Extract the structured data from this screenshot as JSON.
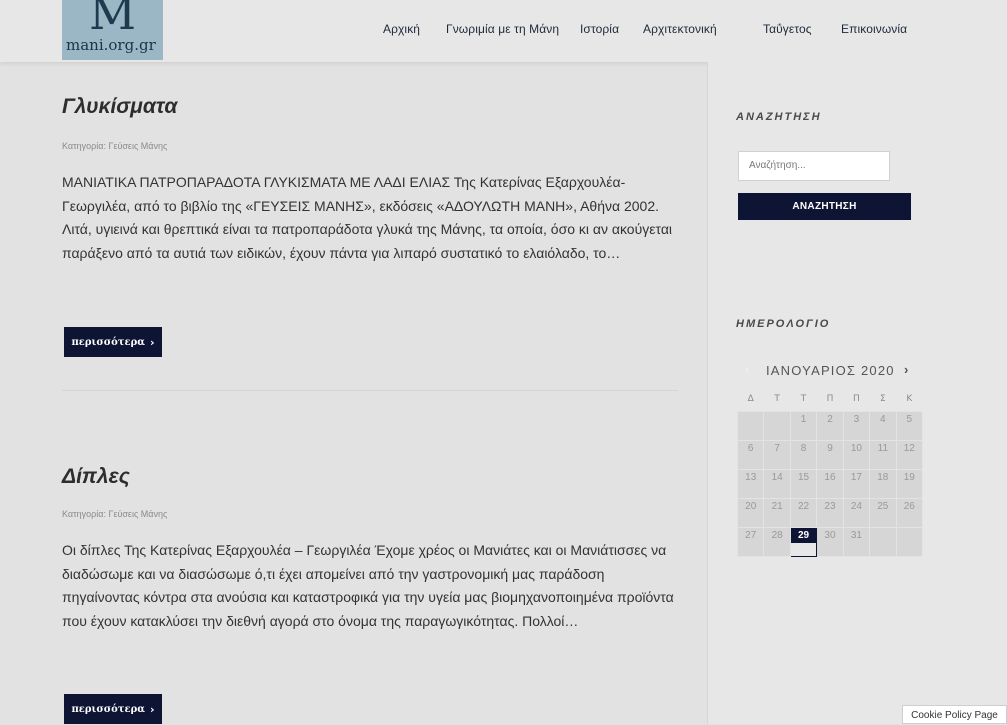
{
  "site": {
    "logo_mark": "M",
    "logo_text": "mani.org.gr"
  },
  "nav": [
    "Αρχική",
    "Γνωριμία με τη Μάνη",
    "Ιστορία",
    "Αρχιτεκτονική",
    "Ταΰγετος",
    "Επικοινωνία"
  ],
  "posts": [
    {
      "title": "Γλυκίσματα",
      "category": "Κατηγορία: Γεύσεις Μάνης",
      "excerpt": "ΜΑΝΙΑΤΙΚΑ ΠΑΤΡΟΠΑΡΑΔΟΤΑ ΓΛΥΚΙΣΜΑΤΑ ΜΕ ΛΑΔΙ ΕΛΙΑΣ Της Κατερίνας Εξαρχουλέα-Γεωργιλέα, από το βιβλίο της «ΓΕΥΣΕΙΣ ΜΑΝΗΣ», εκδόσεις «ΑΔΟΥΛΩΤΗ ΜΑΝΗ», Αθήνα 2002. Λιτά, υγιεινά και θρεπτικά είναι τα πατροπαράδοτα γλυκά της Μάνης, τα οποία, όσο κι αν ακούγεται παράξενο από τα αυτιά των ειδικών, έχουν πάντα για λιπαρό συστατικό το ελαιόλαδο, το…",
      "more": "περισσότερα",
      "more_icon": "chevron-right-icon"
    },
    {
      "title": "Δίπλες",
      "category": "Κατηγορία: Γεύσεις Μάνης",
      "excerpt": "Οι δίπλες Της Κατερίνας Εξαρχουλέα – Γεωργιλέα Έχομε χρέος οι Μανιάτες και οι Μανιάτισσες να διαδώσωμε και να διασώσωμε ό,τι έχει απομείνει από την γαστρονομική μας παράδοση πηγαίνοντας κόντρα στα ανούσια και καταστροφικά για την υγεία μας βιομηχανοποιημένα προϊόντα που έχουν κατακλύσει την διεθνή αγορά στο όνομα της παραγωγικότητας. Πολλοί…",
      "more": "περισσότερα",
      "more_icon": "chevron-right-icon"
    }
  ],
  "search": {
    "title": "ΑΝΑΖΗΤΗΣΗ",
    "placeholder": "Αναζήτηση...",
    "button": "ΑΝΑΖΗΤΗΣΗ"
  },
  "calendar": {
    "title": "ΗΜΕΡΟΛΟΓΙΟ",
    "caption": "ΙΑΝΟΥΑΡΙΟΣ 2020",
    "prev_icon": "chevron-left-icon",
    "next_icon": "chevron-right-icon",
    "weekdays": [
      "Δ",
      "Τ",
      "Τ",
      "Π",
      "Π",
      "Σ",
      "Κ"
    ],
    "weeks": [
      [
        "",
        "",
        "1",
        "2",
        "3",
        "4",
        "5"
      ],
      [
        "6",
        "7",
        "8",
        "9",
        "10",
        "11",
        "12"
      ],
      [
        "13",
        "14",
        "15",
        "16",
        "17",
        "18",
        "19"
      ],
      [
        "20",
        "21",
        "22",
        "23",
        "24",
        "25",
        "26"
      ],
      [
        "27",
        "28",
        "29",
        "30",
        "31",
        "",
        ""
      ]
    ],
    "today": "29"
  },
  "cookie": "Cookie Policy Page",
  "colors": {
    "accent": "#0e1433",
    "background": "#e2e2e2"
  }
}
